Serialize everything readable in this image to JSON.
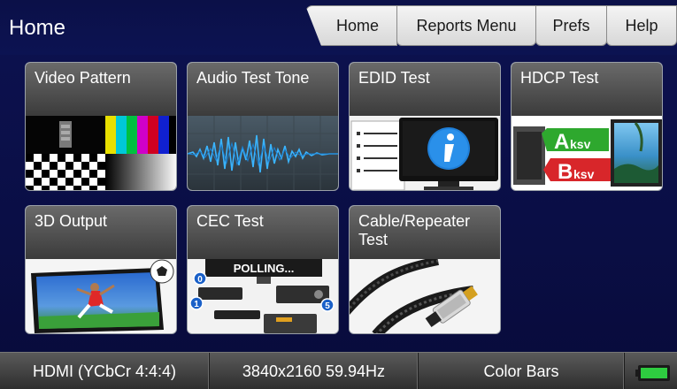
{
  "header": {
    "title": "Home"
  },
  "tabs": [
    {
      "label": "Home"
    },
    {
      "label": "Reports Menu"
    },
    {
      "label": "Prefs"
    },
    {
      "label": "Help"
    }
  ],
  "tiles": [
    {
      "label": "Video Pattern",
      "icon": "video-pattern-icon"
    },
    {
      "label": "Audio Test Tone",
      "icon": "audio-waveform-icon"
    },
    {
      "label": "EDID Test",
      "icon": "edid-info-icon"
    },
    {
      "label": "HDCP Test",
      "icon": "hdcp-keys-icon",
      "key_a": "A",
      "key_a_sub": "ksv",
      "key_b": "B",
      "key_b_sub": "ksv"
    },
    {
      "label": "3D Output",
      "icon": "3d-output-icon"
    },
    {
      "label": "CEC Test",
      "icon": "cec-polling-icon",
      "polling": "POLLING...",
      "node_a": "0",
      "node_b": "1",
      "node_c": "5"
    },
    {
      "label": "Cable/Repeater Test",
      "icon": "hdmi-cable-icon"
    }
  ],
  "status": {
    "interface": "HDMI (YCbCr 4:4:4)",
    "resolution": "3840x2160 59.94Hz",
    "pattern": "Color Bars",
    "battery_color": "#2ecc40"
  }
}
